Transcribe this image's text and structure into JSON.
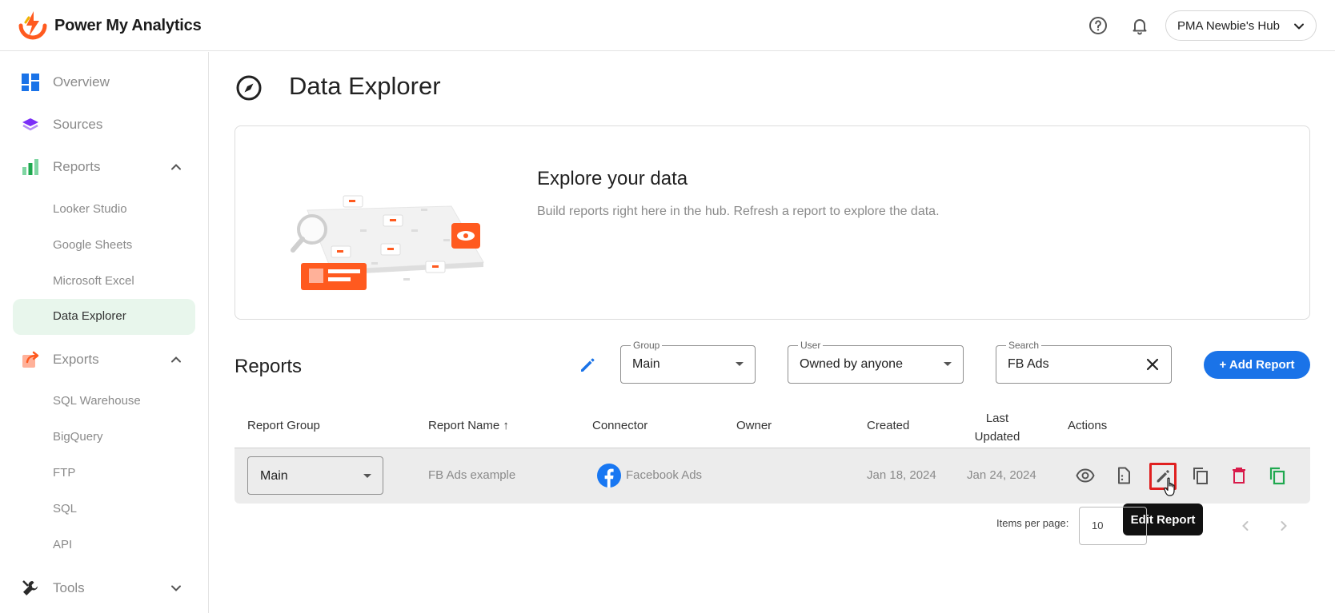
{
  "header": {
    "brand": "Power My Analytics",
    "hub_name": "PMA Newbie's Hub",
    "icons": [
      "help-icon",
      "bell-icon",
      "chevron-down-icon"
    ]
  },
  "sidebar": {
    "items": [
      {
        "label": "Overview",
        "icon": "overview-icon"
      },
      {
        "label": "Sources",
        "icon": "layers-icon"
      },
      {
        "label": "Reports",
        "icon": "bar-chart-icon",
        "expanded": true,
        "children": [
          "Looker Studio",
          "Google Sheets",
          "Microsoft Excel",
          "Data Explorer"
        ]
      },
      {
        "label": "Exports",
        "icon": "export-icon",
        "expanded": true,
        "children": [
          "SQL Warehouse",
          "BigQuery",
          "FTP",
          "SQL",
          "API"
        ]
      },
      {
        "label": "Tools",
        "icon": "wrench-icon",
        "expanded": false
      }
    ],
    "active_item": "Data Explorer"
  },
  "page": {
    "title": "Data Explorer",
    "hero_title": "Explore your data",
    "hero_subtitle": "Build reports right here in the hub. Refresh a report to explore the data."
  },
  "reports": {
    "title": "Reports",
    "group_filter": {
      "label": "Group",
      "value": "Main"
    },
    "user_filter": {
      "label": "User",
      "value": "Owned by anyone"
    },
    "search": {
      "label": "Search",
      "value": "FB Ads"
    },
    "add_button": "+ Add Report",
    "columns": [
      "Report Group",
      "Report Name ↑",
      "Connector",
      "Owner",
      "Created",
      "Last Updated",
      "Actions"
    ],
    "rows": [
      {
        "group": "Main",
        "name": "FB Ads example",
        "connector": "Facebook Ads",
        "owner": "",
        "created": "Jan 18, 2024",
        "updated": "Jan 24, 2024"
      }
    ],
    "tooltip": "Edit Report",
    "items_per_page_label": "Items per page:",
    "items_per_page": "10"
  },
  "colors": {
    "accent_blue": "#1a73e8",
    "brand_orange": "#ff5a1f",
    "delete_red": "#d81b4a",
    "copy_green": "#1fa84f",
    "active_nav_bg": "#e8f6ec"
  }
}
